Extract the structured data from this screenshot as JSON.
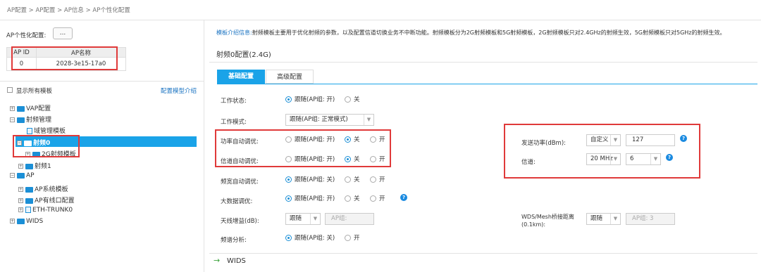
{
  "breadcrumb": "AP配置 > AP配置 > AP信息 > AP个性化配置",
  "left": {
    "config_label": "AP个性化配置:",
    "config_button": "...",
    "table": {
      "headers": [
        "AP ID",
        "AP名称"
      ],
      "rows": [
        [
          "0",
          "2028-3e15-17a0"
        ]
      ]
    },
    "show_all_label": "显示所有模板",
    "intro_link": "配置模型介绍",
    "tree": {
      "vap": "VAP配置",
      "radio_mgmt": "射频管理",
      "domain_tpl": "域管理模板",
      "radio0": "射频0",
      "tpl_2g": "2G射频模板",
      "radio1": "射频1",
      "ap": "AP",
      "ap_sys": "AP系统模板",
      "ap_wired": "AP有线口配置",
      "eth_trunk": "ETH-TRUNK0",
      "wids": "WIDS"
    }
  },
  "right": {
    "intro_prefix": "模板介绍信息:",
    "intro_text": "射频模板主要用于优化射频的参数，以及配置信道切换业务不中断功能。射频模板分为2G射频模板和5G射频模板，2G射频模板只对2.4GHz的射频生效，5G射频模板只对5GHz的射频生效。",
    "section_title": "射频0配置(2.4G)",
    "tabs": [
      "基础配置",
      "高级配置"
    ],
    "rows": {
      "work_status": {
        "label": "工作状态:",
        "opt1": "跟随(AP组: 开)",
        "opt2": "关"
      },
      "work_mode": {
        "label": "工作模式:",
        "value": "跟随(AP组: 正常模式)"
      },
      "power_auto": {
        "label": "功率自动调优:",
        "opt1": "跟随(AP组: 开)",
        "opt2": "关",
        "opt3": "开"
      },
      "channel_auto": {
        "label": "信道自动调优:",
        "opt1": "跟随(AP组: 开)",
        "opt2": "关",
        "opt3": "开"
      },
      "bandwidth_auto": {
        "label": "频宽自动调优:",
        "opt1": "跟随(AP组: 关)",
        "opt2": "关",
        "opt3": "开"
      },
      "big_data": {
        "label": "大数据调优:",
        "opt1": "跟随(AP组: 开)",
        "opt2": "关",
        "opt3": "开"
      },
      "antenna_gain": {
        "label": "天线增益(dB):",
        "select": "跟随",
        "placeholder": "AP组:"
      },
      "spectrum": {
        "label": "频谱分析:",
        "opt1": "跟随(AP组: 关)",
        "opt2": "开"
      }
    },
    "power": {
      "label": "发送功率(dBm):",
      "select": "自定义",
      "value": "127"
    },
    "channel": {
      "label": "信道:",
      "bw": "20 MHz",
      "ch": "6"
    },
    "wds": {
      "label": "WDS/Mesh桥接距离\n(0.1km):",
      "select": "跟随",
      "placeholder": "AP组: 3"
    },
    "wids": "WIDS"
  }
}
